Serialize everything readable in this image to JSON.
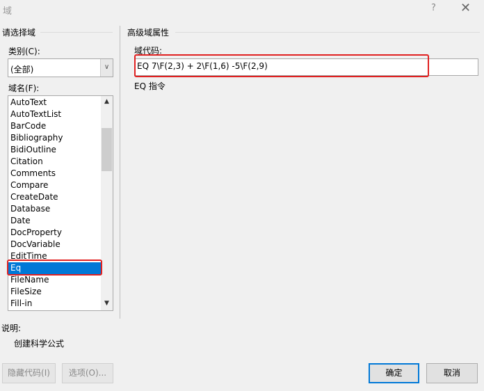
{
  "title": "域",
  "titlebar": {
    "help": "?",
    "close": "✕"
  },
  "left": {
    "group_label": "请选择域",
    "category_label": "类别(C):",
    "category_value": "(全部)",
    "field_names_label": "域名(F):",
    "field_names": [
      "AutoText",
      "AutoTextList",
      "BarCode",
      "Bibliography",
      "BidiOutline",
      "Citation",
      "Comments",
      "Compare",
      "CreateDate",
      "Database",
      "Date",
      "DocProperty",
      "DocVariable",
      "EditTime",
      "Eq",
      "FileName",
      "FileSize",
      "Fill-in"
    ],
    "selected": "Eq"
  },
  "right": {
    "group_label": "高级域属性",
    "code_label": "域代码:",
    "code_value": "EQ 7\\F(2,3) + 2\\F(1,6) -5\\F(2,9)",
    "code_hint": "EQ 指令"
  },
  "description": {
    "label": "说明:",
    "text": "创建科学公式"
  },
  "buttons": {
    "hide_codes": "隐藏代码(I)",
    "options": "选项(O)...",
    "ok": "确定",
    "cancel": "取消"
  },
  "colors": {
    "highlight": "#0078d7",
    "annotation": "#e02020"
  }
}
